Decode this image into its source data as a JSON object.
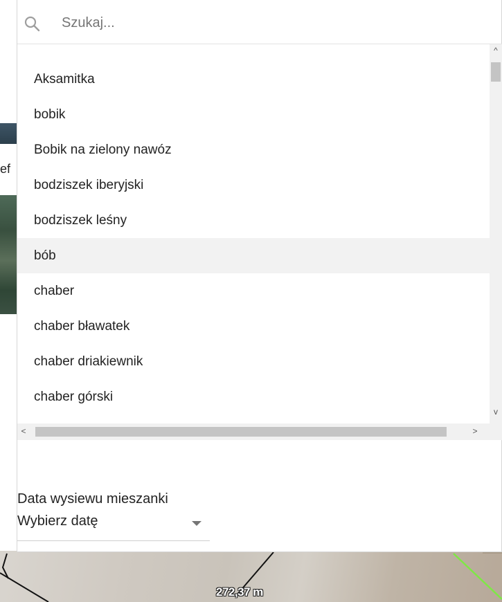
{
  "search": {
    "placeholder": "Szukaj...",
    "value": "",
    "icon": "search-icon"
  },
  "list": {
    "items": [
      "Aksamitka",
      "bobik",
      "Bobik na zielony nawóz",
      "bodziszek iberyjski",
      "bodziszek leśny",
      "bób",
      "chaber",
      "chaber bławatek",
      "chaber driakiewnik",
      "chaber górski"
    ],
    "highlighted_index": 5
  },
  "scrollbars": {
    "up_arrow": "^",
    "down_arrow": "v",
    "left_arrow": "<",
    "right_arrow": ">"
  },
  "date_field": {
    "label": "Data wysiewu mieszanki",
    "value": "Wybierz datę"
  },
  "map": {
    "left_text": "ef",
    "scale_label": "272,37 m",
    "line_color": "#7ee845"
  }
}
